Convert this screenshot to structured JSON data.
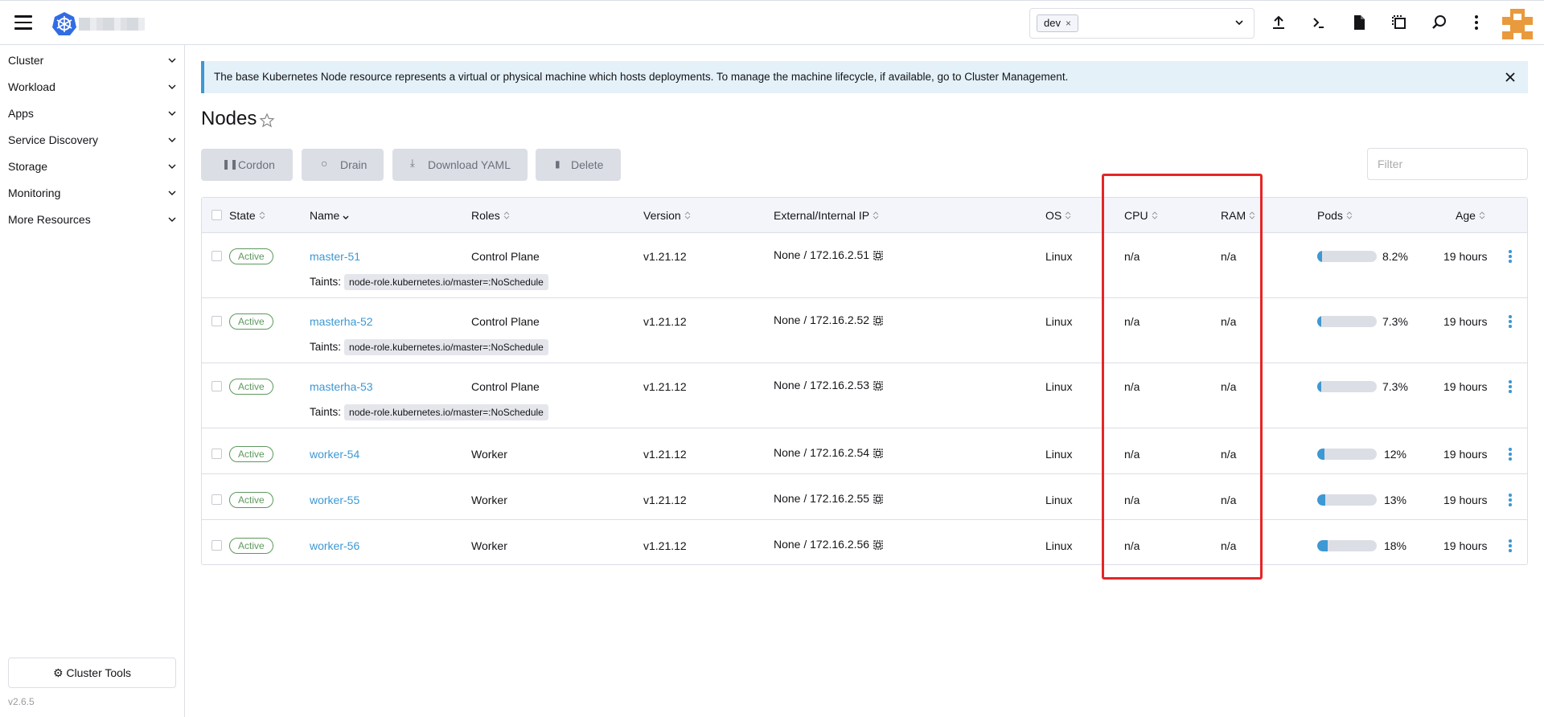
{
  "header": {
    "namespace_chip": "dev",
    "namespace_remove": "×"
  },
  "sidebar": {
    "groups": [
      {
        "label": "Cluster"
      },
      {
        "label": "Workload"
      },
      {
        "label": "Apps"
      },
      {
        "label": "Service Discovery"
      },
      {
        "label": "Storage"
      },
      {
        "label": "Monitoring"
      },
      {
        "label": "More Resources"
      }
    ],
    "cluster_tools": "Cluster Tools",
    "version": "v2.6.5"
  },
  "banner": {
    "text": "The base Kubernetes Node resource represents a virtual or physical machine which hosts deployments. To manage the machine lifecycle, if available, go to Cluster Management."
  },
  "page": {
    "title": "Nodes"
  },
  "actions": {
    "cordon": "Cordon",
    "drain": "Drain",
    "download_yaml": "Download YAML",
    "delete": "Delete",
    "filter_placeholder": "Filter"
  },
  "table": {
    "columns": {
      "state": "State",
      "name": "Name",
      "roles": "Roles",
      "version": "Version",
      "ip": "External/Internal IP",
      "os": "OS",
      "cpu": "CPU",
      "ram": "RAM",
      "pods": "Pods",
      "age": "Age"
    },
    "taints_label": "Taints:",
    "rows": [
      {
        "state": "Active",
        "name": "master-51",
        "roles": "Control Plane",
        "version": "v1.21.12",
        "ip": "None / 172.16.2.51",
        "os": "Linux",
        "cpu": "n/a",
        "ram": "n/a",
        "pods": "8.2%",
        "pods_fraction": 0.082,
        "age": "19 hours",
        "taint": "node-role.kubernetes.io/master=:NoSchedule"
      },
      {
        "state": "Active",
        "name": "masterha-52",
        "roles": "Control Plane",
        "version": "v1.21.12",
        "ip": "None / 172.16.2.52",
        "os": "Linux",
        "cpu": "n/a",
        "ram": "n/a",
        "pods": "7.3%",
        "pods_fraction": 0.073,
        "age": "19 hours",
        "taint": "node-role.kubernetes.io/master=:NoSchedule"
      },
      {
        "state": "Active",
        "name": "masterha-53",
        "roles": "Control Plane",
        "version": "v1.21.12",
        "ip": "None / 172.16.2.53",
        "os": "Linux",
        "cpu": "n/a",
        "ram": "n/a",
        "pods": "7.3%",
        "pods_fraction": 0.073,
        "age": "19 hours",
        "taint": "node-role.kubernetes.io/master=:NoSchedule"
      },
      {
        "state": "Active",
        "name": "worker-54",
        "roles": "Worker",
        "version": "v1.21.12",
        "ip": "None / 172.16.2.54",
        "os": "Linux",
        "cpu": "n/a",
        "ram": "n/a",
        "pods": "12%",
        "pods_fraction": 0.12,
        "age": "19 hours"
      },
      {
        "state": "Active",
        "name": "worker-55",
        "roles": "Worker",
        "version": "v1.21.12",
        "ip": "None / 172.16.2.55",
        "os": "Linux",
        "cpu": "n/a",
        "ram": "n/a",
        "pods": "13%",
        "pods_fraction": 0.13,
        "age": "19 hours"
      },
      {
        "state": "Active",
        "name": "worker-56",
        "roles": "Worker",
        "version": "v1.21.12",
        "ip": "None / 172.16.2.56",
        "os": "Linux",
        "cpu": "n/a",
        "ram": "n/a",
        "pods": "18%",
        "pods_fraction": 0.18,
        "age": "19 hours"
      }
    ]
  },
  "colors": {
    "accent": "#3d98d3",
    "active_badge": "#5d995d",
    "highlight_box": "#e52626",
    "avatar": "#e89a3c"
  },
  "icons": [
    "hamburger-icon",
    "kubernetes-logo-icon",
    "chevron-down-icon",
    "upload-icon",
    "terminal-icon",
    "file-icon",
    "copy-config-icon",
    "search-icon",
    "kebab-menu-icon",
    "close-icon",
    "star-icon",
    "pause-icon",
    "circle-icon",
    "download-icon",
    "trash-icon",
    "gear-icon",
    "sort-icon",
    "clipboard-icon"
  ]
}
